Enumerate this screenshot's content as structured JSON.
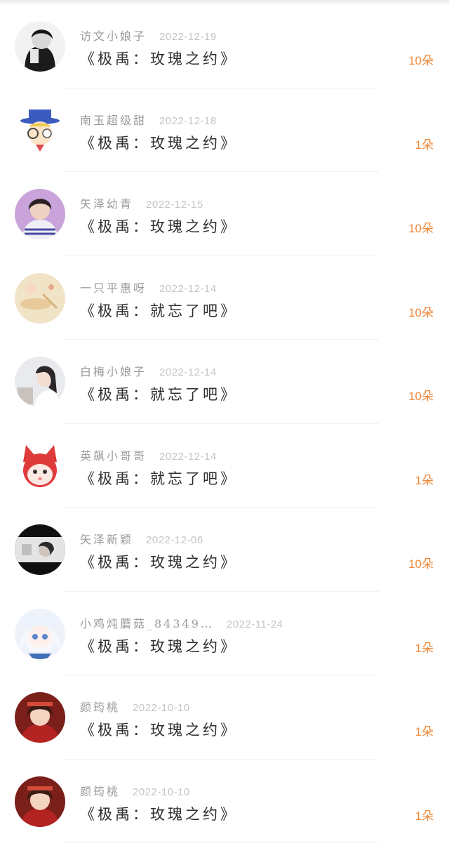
{
  "gifts": [
    {
      "user": "访文小娘子",
      "date": "2022-12-19",
      "title": "《极禹：玫瑰之约》",
      "count": "10朵",
      "avatar": "photo-dark-portrait"
    },
    {
      "user": "南玉超级甜",
      "date": "2022-12-18",
      "title": "《极禹：玫瑰之约》",
      "count": "1朵",
      "avatar": "cartoon-detective"
    },
    {
      "user": "矢泽幼青",
      "date": "2022-12-15",
      "title": "《极禹：玫瑰之约》",
      "count": "10朵",
      "avatar": "photo-boy-purple"
    },
    {
      "user": "一只平惠呀",
      "date": "2022-12-14",
      "title": "《极禹：就忘了吧》",
      "count": "10朵",
      "avatar": "illustration-beige"
    },
    {
      "user": "白梅小娘子",
      "date": "2022-12-14",
      "title": "《极禹：就忘了吧》",
      "count": "10朵",
      "avatar": "photo-girl-light"
    },
    {
      "user": "英飙小哥哥",
      "date": "2022-12-14",
      "title": "《极禹：就忘了吧》",
      "count": "1朵",
      "avatar": "cartoon-red-cat"
    },
    {
      "user": "矢泽新颖",
      "date": "2022-12-06",
      "title": "《极禹：玫瑰之约》",
      "count": "10朵",
      "avatar": "photo-black-frame"
    },
    {
      "user": "小鸡炖蘑菇_84349…",
      "date": "2022-11-24",
      "title": "《极禹：玫瑰之约》",
      "count": "1朵",
      "avatar": "anime-white-hair"
    },
    {
      "user": "颜筠桃",
      "date": "2022-10-10",
      "title": "《极禹：玫瑰之约》",
      "count": "1朵",
      "avatar": "photo-girl-red"
    },
    {
      "user": "颜筠桃",
      "date": "2022-10-10",
      "title": "《极禹：玫瑰之约》",
      "count": "1朵",
      "avatar": "photo-girl-red"
    }
  ]
}
